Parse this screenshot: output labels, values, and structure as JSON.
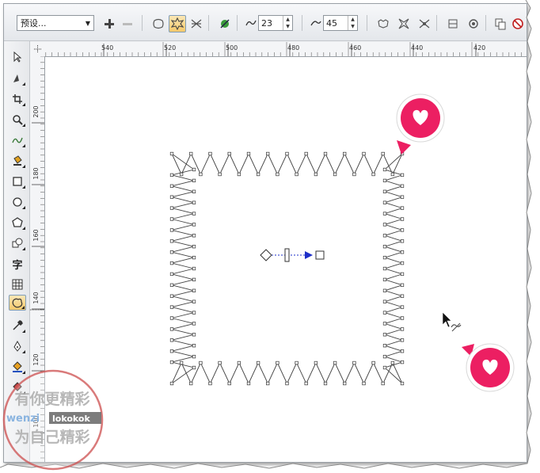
{
  "propbar": {
    "preset_value": "预设...",
    "smoothness_value": "23",
    "node_value": "45"
  },
  "ruler": {
    "h_labels": [
      "540",
      "520",
      "500",
      "480",
      "460",
      "440",
      "420"
    ],
    "v_labels": [
      "200",
      "180",
      "160",
      "140",
      "120",
      "100"
    ]
  },
  "toolbox": {
    "text_tool_glyph": "字"
  },
  "watermark": {
    "line1": "有你更精彩",
    "line2_left": "wenzi",
    "line2_right": "lokokok",
    "line3": "为自己精彩"
  },
  "colors": {
    "accent_pink": "#ec1f62",
    "selection_blue": "#1e2fc8",
    "watermark_red": "#d05a5a"
  },
  "icons": [
    "preset-dropdown",
    "plus-icon",
    "minus-icon",
    "heart-marker-icon",
    "move-cursor-icon"
  ]
}
